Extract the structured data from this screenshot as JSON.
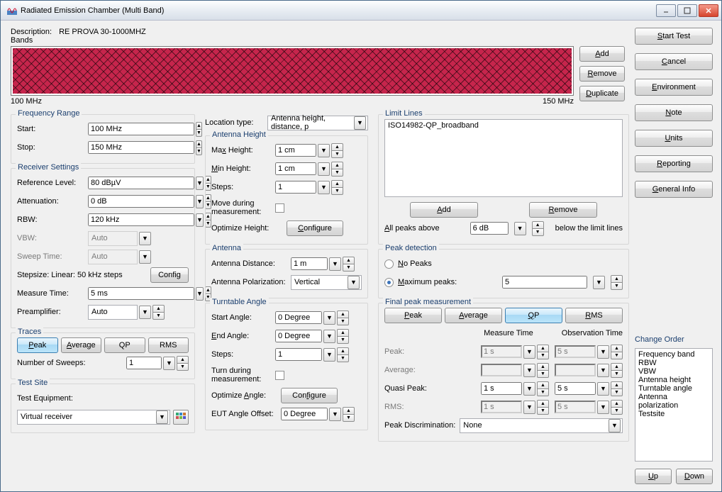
{
  "window": {
    "title": "Radiated Emission Chamber (Multi Band)"
  },
  "header": {
    "description_label": "Description:",
    "description_value": "RE PROVA 30-1000MHZ"
  },
  "bands": {
    "label": "Bands",
    "axis_start": "100 MHz",
    "axis_stop": "150 MHz",
    "add_u": "A",
    "add_rest": "dd",
    "remove_u": "R",
    "remove_rest": "emove",
    "dup_u": "D",
    "dup_rest": "uplicate"
  },
  "freq": {
    "legend": "Frequency Range",
    "start_label": "Start:",
    "start_val": "100 MHz",
    "stop_label": "Stop:",
    "stop_val": "150 MHz"
  },
  "recv": {
    "legend": "Receiver Settings",
    "ref_label": "Reference Level:",
    "ref_val": "80 dBµV",
    "atten_label": "Attenuation:",
    "atten_val": "0 dB",
    "rbw_label": "RBW:",
    "rbw_val": "120 kHz",
    "vbw_label": "VBW:",
    "vbw_val": "Auto",
    "sweep_label": "Sweep Time:",
    "sweep_val": "Auto",
    "stepsize": "Stepsize: Linear: 50 kHz steps",
    "config_btn": "Config",
    "meas_label": "Measure Time:",
    "meas_val": "5 ms",
    "preamp_label": "Preamplifier:",
    "preamp_val": "Auto"
  },
  "traces": {
    "legend": "Traces",
    "peak_u": "P",
    "peak_rest": "eak",
    "avg_u": "A",
    "avg_rest": "verage",
    "qp": "QP",
    "rms": "RMS",
    "sweeps_label": "Number of Sweeps:",
    "sweeps_val": "1"
  },
  "testsite": {
    "legend": "Test Site",
    "equip_label": "Test Equipment:",
    "equip_val": "Virtual receiver"
  },
  "loc": {
    "type_label": "Location type:",
    "type_val": "Antenna height, distance, p"
  },
  "antH": {
    "legend": "Antenna Height",
    "max_pre": "Ma",
    "max_u": "x",
    "max_rest": " Height:",
    "max_val": "1 cm",
    "min_u": "M",
    "min_rest": "in Height:",
    "min_val": "1 cm",
    "steps_label": "Steps:",
    "steps_val": "1",
    "move_label": "Move during measurement:",
    "optimize_label": "Optimize Height:",
    "config_u": "C",
    "config_rest": "onfigure"
  },
  "ant": {
    "legend": "Antenna",
    "dist_label": "Antenna Distance:",
    "dist_val": "1 m",
    "pol_label": "Antenna Polarization:",
    "pol_val": "Vertical"
  },
  "turn": {
    "legend": "Turntable Angle",
    "start_label": "Start Angle:",
    "start_val": "0 Degree",
    "end_u": "E",
    "end_rest": "nd Angle:",
    "end_val": "0 Degree",
    "steps_label": "Steps:",
    "steps_val": "1",
    "turn_label": "Turn during measurement:",
    "optimize_pre": "Optimize ",
    "optimize_u": "A",
    "optimize_rest": "ngle:",
    "config_pre": "Con",
    "config_u": "f",
    "config_rest": "igure",
    "eut_label": "EUT Angle Offset:",
    "eut_val": "0 Degree"
  },
  "limit": {
    "legend": "Limit Lines",
    "items": [
      "ISO14982-QP_broadband"
    ],
    "add_u": "A",
    "add_rest": "dd",
    "remove_u": "R",
    "remove_rest": "emove",
    "allpeaks_u": "A",
    "allpeaks_rest": "ll peaks above",
    "allpeaks_val": "6 dB",
    "below_text": "below the limit lines"
  },
  "peakd": {
    "legend": "Peak detection",
    "nopeaks_u": "N",
    "nopeaks_rest": "o Peaks",
    "maxpeaks_u": "M",
    "maxpeaks_rest": "aximum peaks:",
    "maxpeaks_val": "5"
  },
  "final": {
    "legend": "Final peak measurement",
    "peak_u": "P",
    "peak_rest": "eak",
    "avg_u": "A",
    "avg_rest": "verage",
    "qp_u": "Q",
    "qp_rest": "P",
    "rms_u": "R",
    "rms_rest": "MS",
    "meas_header": "Measure Time",
    "obs_header": "Observation Time",
    "rows": [
      "Peak:",
      "Average:",
      "Quasi Peak:",
      "RMS:"
    ],
    "meas": [
      "1 s",
      "",
      "1 s",
      "1 s"
    ],
    "obs": [
      "5 s",
      "",
      "5 s",
      "5 s"
    ],
    "discrim_label": "Peak Discrimination:",
    "discrim_val": "None"
  },
  "side": {
    "start_u": "S",
    "start_rest": "tart Test",
    "cancel_u": "C",
    "cancel_rest": "ancel",
    "env_u": "E",
    "env_rest": "nvironment",
    "note_u": "N",
    "note_rest": "ote",
    "units_u": "U",
    "units_rest": "nits",
    "report_u": "R",
    "report_rest": "eporting",
    "ginfo_u": "G",
    "ginfo_rest": "eneral Info"
  },
  "order": {
    "label": "Change Order",
    "items": [
      "Frequency band",
      "RBW",
      "VBW",
      "Antenna height",
      "Turntable angle",
      "Antenna polarization",
      "Testsite"
    ],
    "up_u": "U",
    "up_rest": "p",
    "down_u": "D",
    "down_rest": "own"
  }
}
